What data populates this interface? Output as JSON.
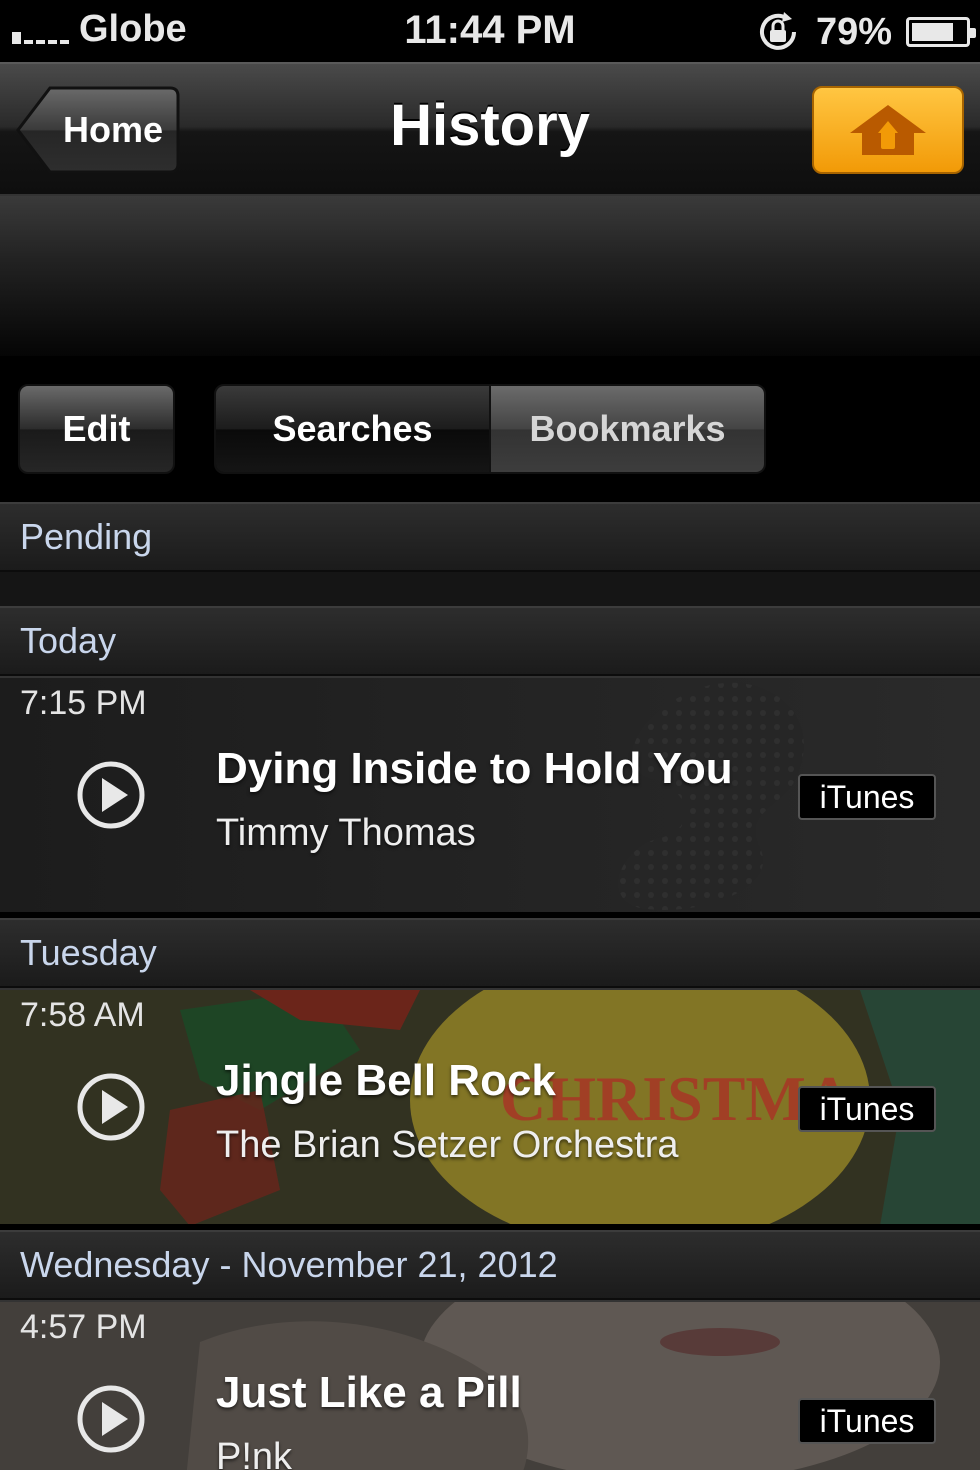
{
  "status_bar": {
    "carrier": "Globe",
    "time": "11:44 PM",
    "battery_percent": "79%",
    "battery_level": 0.79
  },
  "nav_bar": {
    "back_label": "Home",
    "title": "History",
    "upload_icon": "upload-house-icon",
    "accent_color": "#f5a30f"
  },
  "toolbar": {
    "edit_label": "Edit",
    "segments": [
      "Searches",
      "Bookmarks"
    ],
    "selected_segment": "Searches"
  },
  "sections": [
    {
      "label": "Pending",
      "items": []
    },
    {
      "label": "Today",
      "items": [
        {
          "time": "7:15 PM",
          "title": "Dying Inside to Hold You",
          "artist": "Timmy Thomas",
          "store_label": "iTunes"
        }
      ]
    },
    {
      "label": "Tuesday",
      "items": [
        {
          "time": "7:58 AM",
          "title": "Jingle Bell Rock",
          "artist": "The Brian Setzer Orchestra",
          "store_label": "iTunes"
        }
      ]
    },
    {
      "label": "Wednesday - November 21, 2012",
      "items": [
        {
          "time": "4:57 PM",
          "title": "Just Like a Pill",
          "artist": "P!nk",
          "store_label": "iTunes"
        }
      ]
    }
  ]
}
